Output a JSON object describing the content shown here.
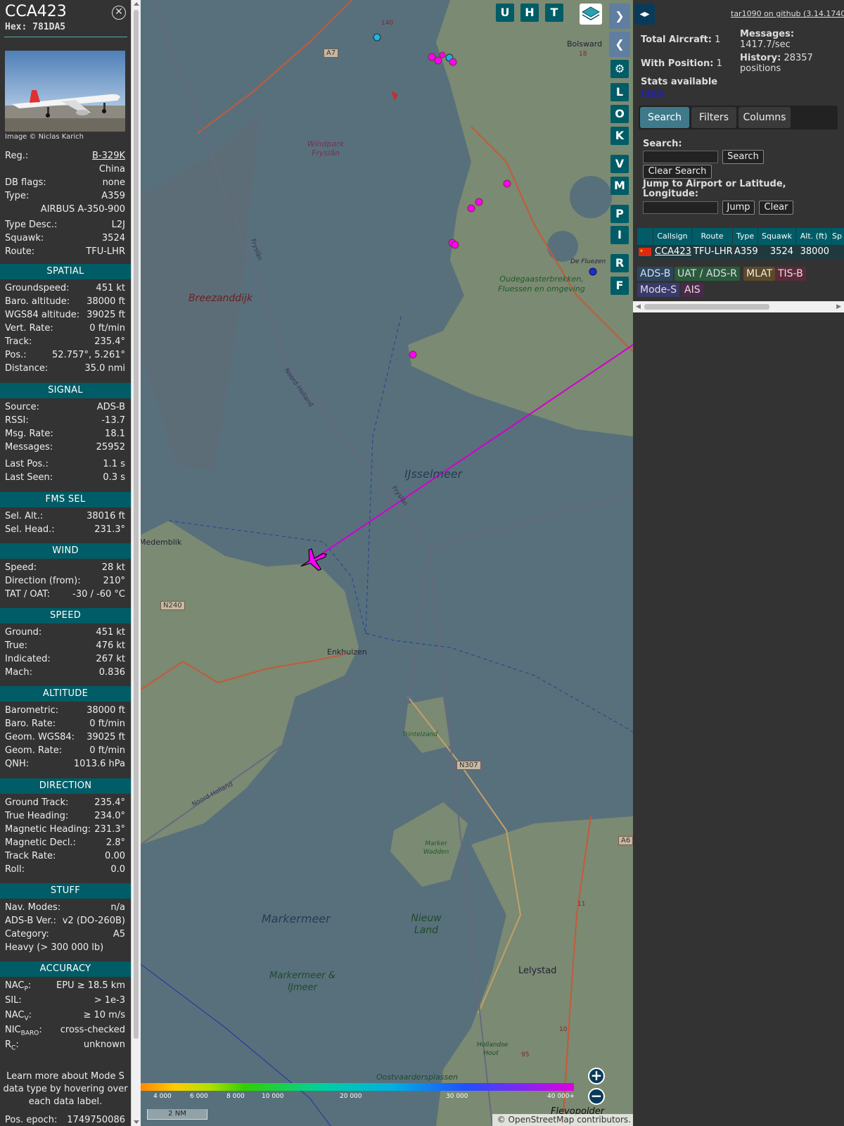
{
  "aircraft": {
    "callsign": "CCA423",
    "hex": "Hex: 781DA5",
    "close_icon": "close-icon",
    "photo_credit": "Image © Niclas Karich",
    "rows": [
      {
        "label": "Reg.:",
        "value": "B-329K"
      },
      {
        "label": "",
        "value": "China"
      },
      {
        "label": "DB flags:",
        "value": "none"
      },
      {
        "label": "Type:",
        "value": "A359"
      },
      {
        "label": "",
        "value": "AIRBUS A-350-900"
      },
      {
        "label": "Type Desc.:",
        "value": "L2J"
      },
      {
        "label": "Squawk:",
        "value": "3524"
      },
      {
        "label": "Route:",
        "value": "TFU-LHR"
      }
    ]
  },
  "sections": {
    "spatial": {
      "title": "SPATIAL",
      "rows": [
        {
          "label": "Groundspeed:",
          "value": "451 kt"
        },
        {
          "label": "Baro. altitude:",
          "value": "38000 ft"
        },
        {
          "label": "WGS84 altitude:",
          "value": "39025 ft"
        },
        {
          "label": "Vert. Rate:",
          "value": "0 ft/min"
        },
        {
          "label": "Track:",
          "value": "235.4°"
        },
        {
          "label": "Pos.:",
          "value": "52.757°, 5.261°"
        },
        {
          "label": "Distance:",
          "value": "35.0 nmi"
        }
      ]
    },
    "signal": {
      "title": "SIGNAL",
      "rows": [
        {
          "label": "Source:",
          "value": "ADS-B"
        },
        {
          "label": "RSSI:",
          "value": "-13.7"
        },
        {
          "label": "Msg. Rate:",
          "value": "18.1"
        },
        {
          "label": "Messages:",
          "value": "25952"
        },
        {
          "label": "Last Pos.:",
          "value": "1.1 s"
        },
        {
          "label": "Last Seen:",
          "value": "0.3 s"
        }
      ]
    },
    "fms": {
      "title": "FMS SEL",
      "rows": [
        {
          "label": "Sel. Alt.:",
          "value": "38016 ft"
        },
        {
          "label": "Sel. Head.:",
          "value": "231.3°"
        }
      ]
    },
    "wind": {
      "title": "WIND",
      "rows": [
        {
          "label": "Speed:",
          "value": "28 kt"
        },
        {
          "label": "Direction (from):",
          "value": "210°"
        },
        {
          "label": "TAT / OAT:",
          "value": "-30 / -60 °C"
        }
      ]
    },
    "speed": {
      "title": "SPEED",
      "rows": [
        {
          "label": "Ground:",
          "value": "451 kt"
        },
        {
          "label": "True:",
          "value": "476 kt"
        },
        {
          "label": "Indicated:",
          "value": "267 kt"
        },
        {
          "label": "Mach:",
          "value": "0.836"
        }
      ]
    },
    "altitude": {
      "title": "ALTITUDE",
      "rows": [
        {
          "label": "Barometric:",
          "value": "38000 ft"
        },
        {
          "label": "Baro. Rate:",
          "value": "0 ft/min"
        },
        {
          "label": "Geom. WGS84:",
          "value": "39025 ft"
        },
        {
          "label": "Geom. Rate:",
          "value": "0 ft/min"
        },
        {
          "label": "QNH:",
          "value": "1013.6 hPa"
        }
      ]
    },
    "direction": {
      "title": "DIRECTION",
      "rows": [
        {
          "label": "Ground Track:",
          "value": "235.4°"
        },
        {
          "label": "True Heading:",
          "value": "234.0°"
        },
        {
          "label": "Magnetic Heading:",
          "value": "231.3°"
        },
        {
          "label": "Magnetic Decl.:",
          "value": "2.8°"
        },
        {
          "label": "Track Rate:",
          "value": "0.00"
        },
        {
          "label": "Roll:",
          "value": "0.0"
        }
      ]
    },
    "stuff": {
      "title": "STUFF",
      "rows": [
        {
          "label": "Nav. Modes:",
          "value": "n/a"
        },
        {
          "label": "ADS-B Ver.:",
          "value": "v2 (DO-260B)"
        },
        {
          "label": "Category:",
          "value": "A5"
        },
        {
          "label": "Heavy (> 300 000 lb)",
          "value": ""
        }
      ]
    },
    "accuracy": {
      "title": "ACCURACY",
      "rows": [
        {
          "label": "NAC",
          "sub": "P",
          "value": "EPU ≥ 18.5 km"
        },
        {
          "label": "SIL:",
          "sub": "",
          "value": "> 1e-3"
        },
        {
          "label": "NAC",
          "sub": "V",
          "value": "≥ 10 m/s"
        },
        {
          "label": "NIC",
          "sub": "BARO",
          "value": "cross-checked"
        },
        {
          "label": "R",
          "sub": "C",
          "value": "unknown"
        }
      ]
    }
  },
  "learn_more": "Learn more about Mode S data type by hovering over each data label.",
  "pos_epoch": {
    "label": "Pos. epoch:",
    "value": "1749750086"
  },
  "map": {
    "buttons_top": [
      "U",
      "H",
      "T"
    ],
    "buttons_side": [
      "L",
      "O",
      "K",
      "V",
      "M",
      "P",
      "I",
      "R",
      "F"
    ],
    "labels": {
      "bolsward": "Bolsward",
      "windpark": "Windpark Fryslân",
      "breezanddijk": "Breezanddijk",
      "fryslan1": "Fryslân",
      "noordholland1": "Noord-Holland",
      "ijsselmeer": "IJsselmeer",
      "fryslan2": "Fryslân",
      "medemblik": "Medemblik",
      "enkhuizen": "Enkhuizen",
      "oudegaster": "Oudegaasterbrekken, Fluessen en omgeving",
      "defluezen": "De Fluezen",
      "trintelzand": "Trintelzand",
      "markerwadden": "Marker Wadden",
      "markermeer": "Markermeer",
      "nieuwland": "Nieuw Land",
      "markermeerij": "Markermeer & IJmeer",
      "lelystad": "Lelystad",
      "noordholland2": "Noord-Holland",
      "oostvaarders": "Oostvaardersplassen",
      "hollandsehout": "Hollandse Hout",
      "flevopolder": "Flevopolder",
      "a7": "A7",
      "a6": "A6",
      "n240": "N240",
      "n307": "N307",
      "r140": "140",
      "r18": "18",
      "r10": "10",
      "r11": "11",
      "r95": "95"
    },
    "altitude_legend": [
      "4 000",
      "6 000",
      "8 000",
      "10 000",
      "20 000",
      "30 000",
      "40 000+"
    ],
    "scale": "2 NM",
    "attribution": "© OpenStreetMap contributors.",
    "colors": {
      "track": "#d000d0",
      "water": "#58707c",
      "land": "#7b8a72"
    }
  },
  "sidebar": {
    "expand_icon": "expand-arrows-icon",
    "github": "tar1090 on github (3.14.1740)",
    "total_aircraft": {
      "label": "Total Aircraft:",
      "value": "1"
    },
    "with_position": {
      "label": "With Position:",
      "value": "1"
    },
    "messages": {
      "label": "Messages:",
      "value": "1417.7/sec"
    },
    "history": {
      "label": "History:",
      "value": "28357 positions"
    },
    "stats_text": "Stats available",
    "stats_link": "here",
    "tabs": [
      "Search",
      "Filters",
      "Columns"
    ],
    "search_label": "Search:",
    "search_button": "Search",
    "clear_search_button": "Clear Search",
    "jump_label": "Jump to Airport or Latitude, Longitude:",
    "jump_button": "Jump",
    "clear_button": "Clear",
    "table": {
      "headers": [
        "",
        "Callsign",
        "Route",
        "Type",
        "Squawk",
        "Alt. (ft)",
        "Sp"
      ],
      "row": {
        "flag": "flag-china-icon",
        "callsign": "CCA423",
        "route": "TFU-LHR",
        "type": "A359",
        "squawk": "3524",
        "alt": "38000"
      }
    },
    "badges": [
      "ADS-B",
      "UAT / ADS-R",
      "MLAT",
      "TIS-B",
      "Mode-S",
      "AIS"
    ]
  }
}
